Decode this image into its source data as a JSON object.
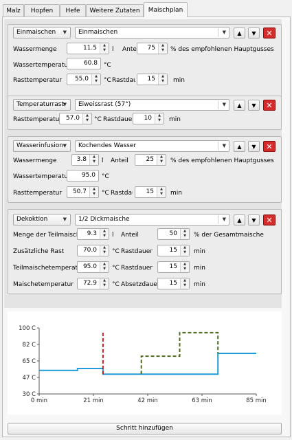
{
  "tabs": [
    "Malz",
    "Hopfen",
    "Hefe",
    "Weitere Zutaten",
    "Maischplan"
  ],
  "steps": [
    {
      "type": "Einmaischen",
      "name": "Einmaischen",
      "rows": [
        {
          "label1": "Wassermenge",
          "value1": "11.5",
          "unit1": "l",
          "label2": "Anteil",
          "value2": "75",
          "suffix": "% des empfohlenen Hauptgusses"
        },
        {
          "label1": "Wassertemperatur",
          "value1": "60.8",
          "unit1": "°C"
        },
        {
          "label1": "Rasttemperatur",
          "value1": "55.0",
          "unit1": "°C",
          "label2": "Rastdauer",
          "value2": "15",
          "suffix": "min"
        }
      ]
    },
    {
      "type": "Temperaturrast",
      "name": "Eiweissrast (57°)",
      "rows": [
        {
          "label1": "Rasttemperatur",
          "value1": "57.0",
          "unit1": "°C",
          "label2": "Rastdauer",
          "value2": "10",
          "suffix": "min"
        }
      ]
    },
    {
      "type": "Wasserinfusion",
      "name": "Kochendes Wasser",
      "rows": [
        {
          "label1": "Wassermenge",
          "value1": "3.8",
          "unit1": "l",
          "label2": "Anteil",
          "value2": "25",
          "suffix": "% des empfohlenen Hauptgusses"
        },
        {
          "label1": "Wassertemperatur",
          "value1": "95.0",
          "unit1": "°C"
        },
        {
          "label1": "Rasttemperatur",
          "value1": "50.7",
          "unit1": "°C",
          "label2": "Rastdauer",
          "value2": "15",
          "suffix": "min"
        }
      ]
    },
    {
      "type": "Dekoktion",
      "name": "1/2 Dickmaische",
      "rows": [
        {
          "label1": "Menge der Teilmaische",
          "value1": "9.3",
          "unit1": "l",
          "label2": "Anteil",
          "value2": "50",
          "suffix": "% der Gesamtmaische"
        },
        {
          "label1": "Zusätzliche Rast",
          "value1": "70.0",
          "unit1": "°C",
          "label2": "Rastdauer",
          "value2": "15",
          "suffix": "min"
        },
        {
          "label1": "Teilmaischetemperatur",
          "value1": "95.0",
          "unit1": "°C",
          "label2": "Rastdauer",
          "value2": "15",
          "suffix": "min"
        },
        {
          "label1": "Maischetemperatur",
          "value1": "72.9",
          "unit1": "°C",
          "label2": "Absetzdauer",
          "value2": "15",
          "suffix": "min"
        }
      ]
    }
  ],
  "icons": {
    "up": "arrow-up-icon",
    "down": "arrow-down-icon",
    "delete": "close-icon",
    "dropdown": "chevron-down-icon"
  },
  "colors": {
    "mash": "#1f9bd7",
    "decoction": "#4e6a1f",
    "infusion": "#c41e24"
  },
  "add_button_label": "Schritt hinzufügen",
  "chart_data": {
    "type": "line",
    "xlabel": "",
    "ylabel": "",
    "xlim": [
      0,
      85
    ],
    "ylim": [
      30,
      100
    ],
    "x_ticks": [
      "0 min",
      "21 min",
      "42 min",
      "63 min",
      "85 min"
    ],
    "y_ticks": [
      "100 C",
      "82 C",
      "65 C",
      "47 C",
      "30 C"
    ],
    "grid": false,
    "series": [
      {
        "style": "solid",
        "color": "#1f9bd7",
        "points": [
          [
            0,
            55
          ],
          [
            15,
            55
          ],
          [
            15,
            57
          ],
          [
            25,
            57
          ],
          [
            25,
            51
          ],
          [
            70,
            51
          ],
          [
            70,
            73
          ],
          [
            85,
            73
          ]
        ]
      },
      {
        "style": "dashed",
        "color": "#c41e24",
        "points": [
          [
            25,
            95
          ],
          [
            25,
            51
          ]
        ]
      },
      {
        "style": "dashed",
        "color": "#4e6a1f",
        "points": [
          [
            40,
            51
          ],
          [
            40,
            70
          ],
          [
            55,
            70
          ],
          [
            55,
            95
          ],
          [
            70,
            95
          ],
          [
            70,
            73
          ]
        ]
      }
    ]
  }
}
